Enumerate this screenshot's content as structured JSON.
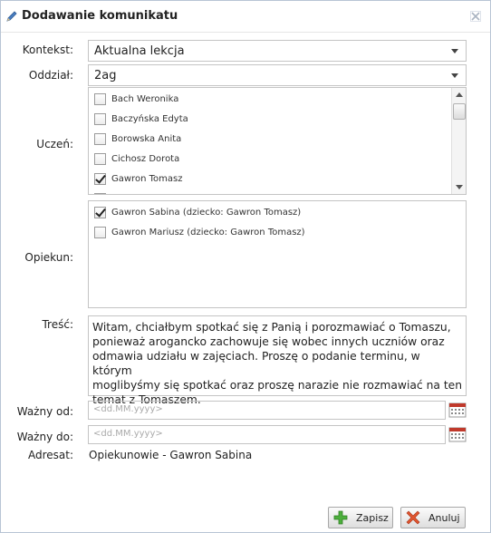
{
  "dialog": {
    "title": "Dodawanie komunikatu",
    "icons": {
      "title": "pencil-icon",
      "close": "close-icon"
    }
  },
  "form": {
    "context": {
      "label": "Kontekst:",
      "value": "Aktualna lekcja"
    },
    "division": {
      "label": "Oddział:",
      "value": "2ag"
    },
    "student": {
      "label": "Uczeń:",
      "items": [
        {
          "name": "Bach Weronika",
          "checked": false
        },
        {
          "name": "Baczyńska Edyta",
          "checked": false
        },
        {
          "name": "Borowska Anita",
          "checked": false
        },
        {
          "name": "Cichosz Dorota",
          "checked": false
        },
        {
          "name": "Gawron Tomasz",
          "checked": true
        }
      ]
    },
    "guardian": {
      "label": "Opiekun:",
      "items": [
        {
          "name": "Gawron Sabina (dziecko: Gawron Tomasz)",
          "checked": true
        },
        {
          "name": "Gawron Mariusz (dziecko: Gawron Tomasz)",
          "checked": false
        }
      ]
    },
    "content": {
      "label": "Treść:",
      "value": "Witam, chciałbym spotkać się z Panią i porozmawiać o Tomaszu,\nponieważ arogancko zachowuje się wobec innych uczniów oraz\nodmawia udziału w zajęciach. Proszę o podanie terminu, w którym\nmoglibyśmy się spotkać oraz proszę narazie nie rozmawiać na ten\ntemat z Tomaszem."
    },
    "valid_from": {
      "label": "Ważny od:",
      "placeholder": "<dd.MM.yyyy>"
    },
    "valid_to": {
      "label": "Ważny do:",
      "placeholder": "<dd.MM.yyyy>"
    },
    "recipient": {
      "label": "Adresat:",
      "value": "Opiekunowie - Gawron Sabina"
    }
  },
  "buttons": {
    "save": "Zapisz",
    "cancel": "Anuluj"
  },
  "colors": {
    "save_icon": "#4caf3c",
    "cancel_icon": "#e0552e",
    "calendar_icon": "#c0392b"
  }
}
